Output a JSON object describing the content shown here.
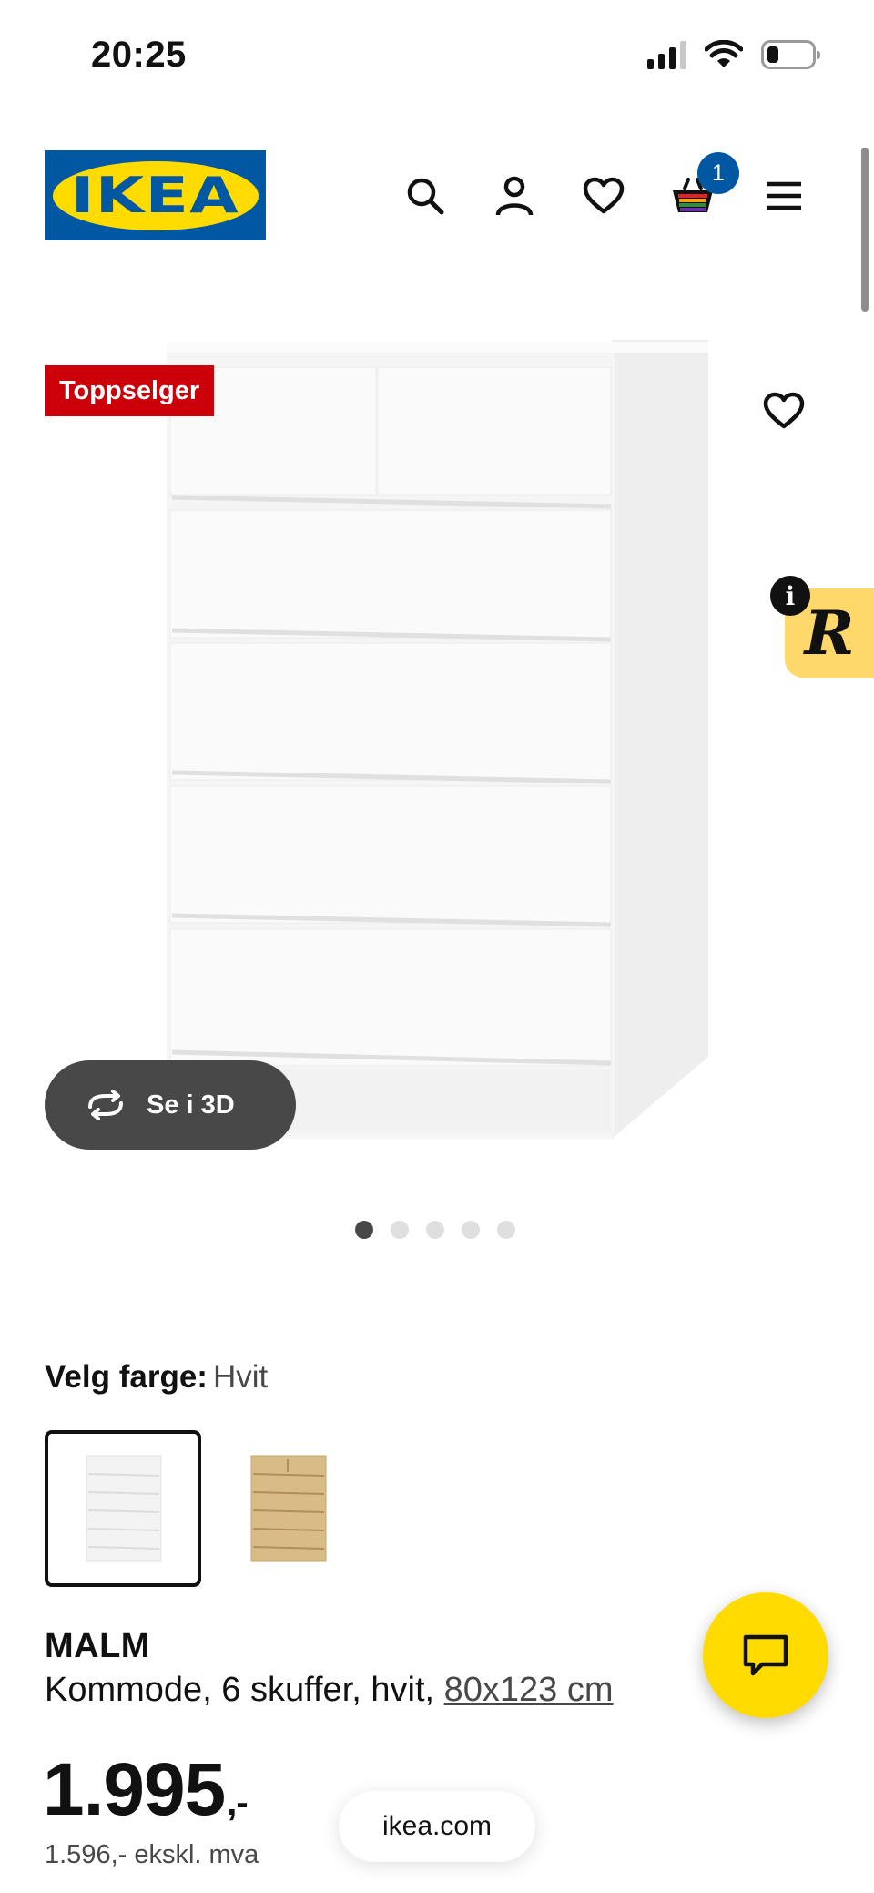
{
  "status_bar": {
    "time": "20:25"
  },
  "header": {
    "logo_text": "IKEA",
    "icons": [
      "search-icon",
      "account-icon",
      "wishlist-icon",
      "cart-icon",
      "menu-icon"
    ],
    "cart_count": "1"
  },
  "gallery": {
    "badge": "Toppselger",
    "view_3d_label": "Se i 3D",
    "slide_count": 5,
    "active_slide": 1
  },
  "color_chooser": {
    "label": "Velg farge:",
    "selected": "Hvit",
    "options": [
      "white",
      "white-stained-oak"
    ]
  },
  "product": {
    "name": "MALM",
    "description": "Kommode, 6 skuffer, hvit,",
    "size": "80x123 cm",
    "price": "1.995",
    "price_suffix": ",-",
    "price_ex_vat": "1.596,- ekskl. mva"
  },
  "browser": {
    "url": "ikea.com"
  },
  "colors": {
    "ikea_blue": "#0058a3",
    "ikea_yellow": "#ffdb00",
    "badge_red": "#cc0008",
    "button_dark": "#484848"
  }
}
